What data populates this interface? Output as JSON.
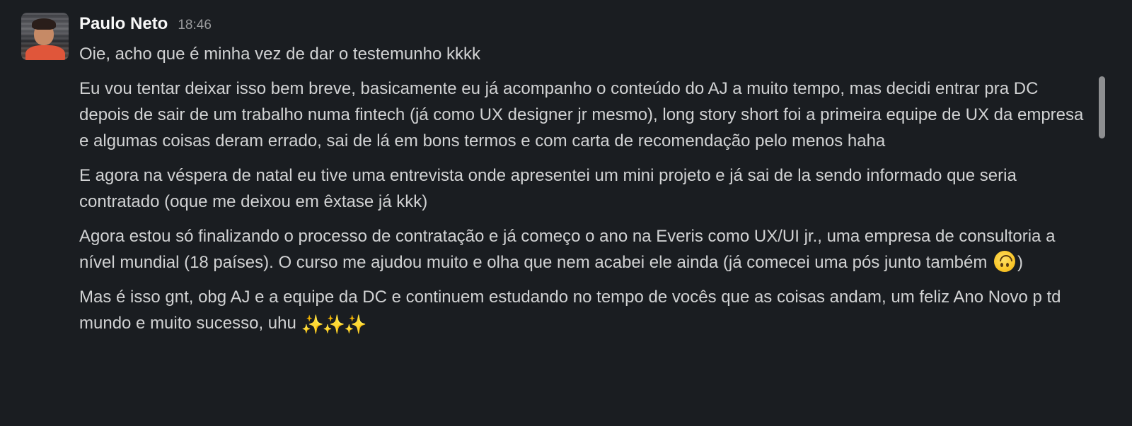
{
  "message": {
    "sender": "Paulo Neto",
    "timestamp": "18:46",
    "paragraphs": [
      "Oie, acho que é minha vez de dar o testemunho kkkk",
      "Eu vou tentar deixar isso bem breve, basicamente eu já acompanho o conteúdo do AJ a muito tempo, mas decidi entrar pra DC depois de sair de um trabalho numa fintech (já como UX designer jr mesmo), long story short foi a primeira equipe de UX da empresa e algumas coisas deram errado, sai de lá em bons termos e com carta de recomendação pelo menos haha",
      "E agora na véspera de natal eu tive uma entrevista onde apresentei um mini projeto e já sai de la sendo informado que seria contratado (oque me deixou em êxtase já kkk)",
      "Agora estou só finalizando o processo de contratação e já começo o ano na Everis como UX/UI jr., uma empresa de consultoria a nível mundial (18 países). O curso me ajudou muito e olha que nem acabei ele ainda (já comecei uma pós junto também",
      ")",
      "Mas é isso gnt, obg AJ e a equipe da DC e continuem estudando no tempo de vocês que as coisas andam, um feliz Ano Novo p td mundo e muito sucesso, uhu"
    ],
    "emojis": {
      "upside_down": "upside-down-face-icon",
      "sparkles": "✨✨✨"
    }
  },
  "colors": {
    "background": "#1a1d21",
    "text": "#d1d2d3",
    "sender": "#f8f8f8",
    "timestamp": "#9b9c9e",
    "scrollbar": "#8e8f91"
  }
}
